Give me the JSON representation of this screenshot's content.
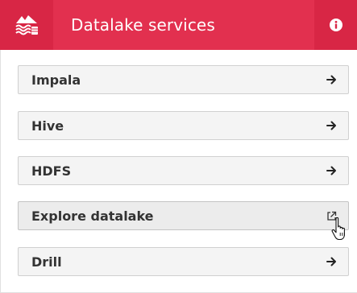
{
  "header": {
    "title": "Datalake services",
    "logo_icon": "datalake-waves-icon",
    "info_icon": "info-icon",
    "colors": {
      "background": "#e2304f",
      "accent": "#d82645",
      "text": "#ffffff"
    }
  },
  "services": [
    {
      "label": "Impala",
      "icon": "arrow-right-icon"
    },
    {
      "label": "Hive",
      "icon": "arrow-right-icon"
    },
    {
      "label": "HDFS",
      "icon": "arrow-right-icon"
    },
    {
      "label": "Explore datalake",
      "icon": "external-link-icon",
      "hovered": true
    },
    {
      "label": "Drill",
      "icon": "arrow-right-icon"
    }
  ],
  "cursor": "hand-pointer-icon"
}
